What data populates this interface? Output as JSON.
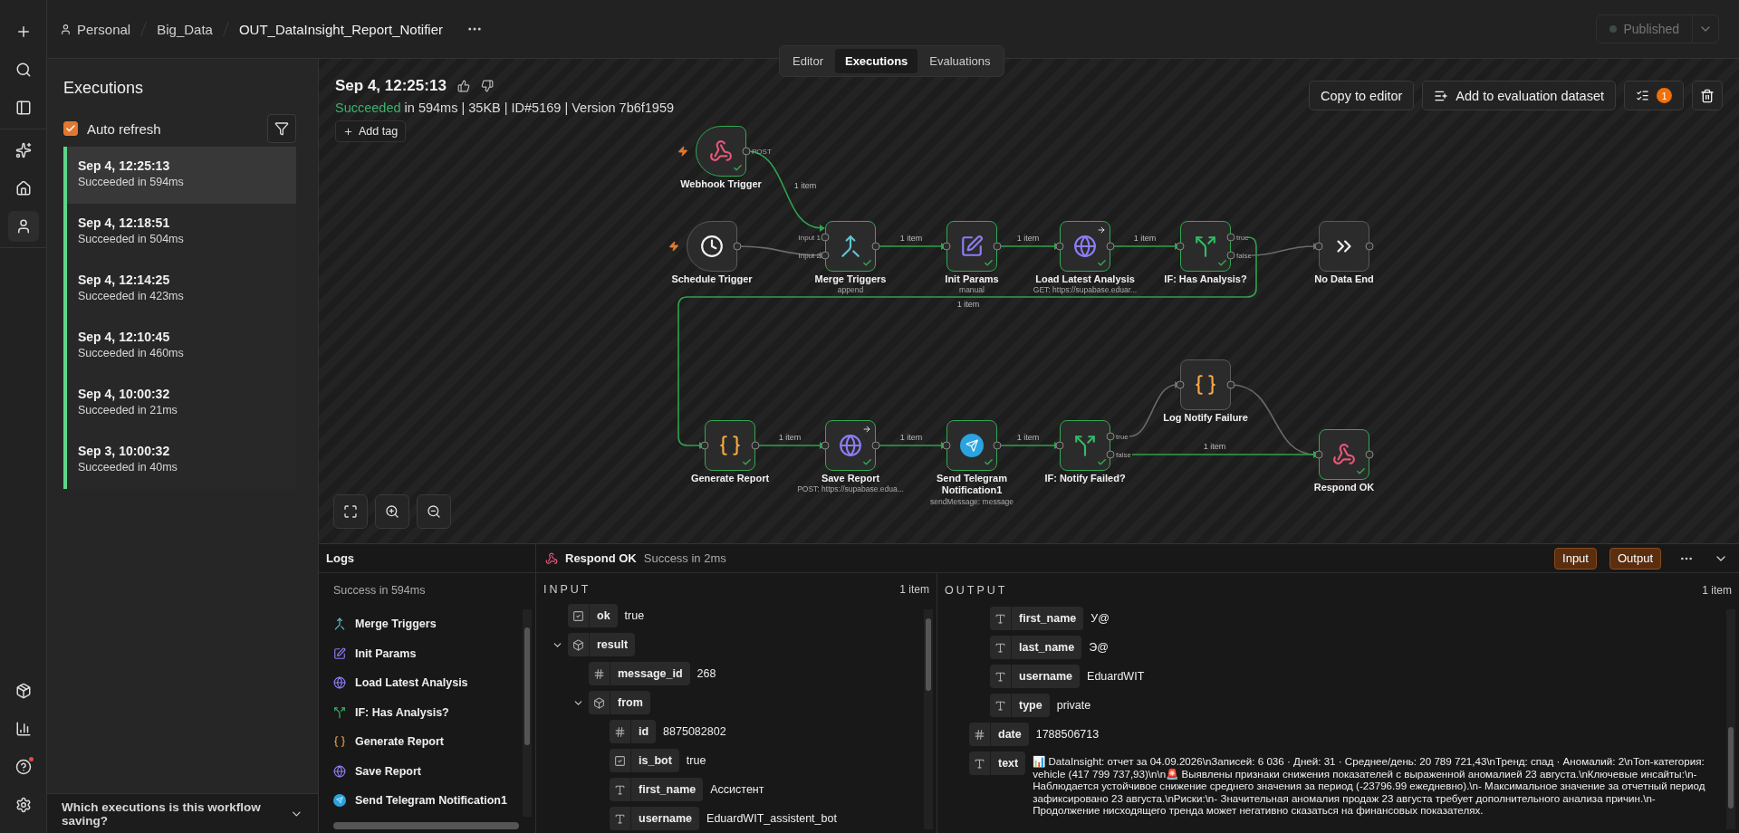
{
  "breadcrumb": {
    "items": [
      "Personal",
      "Big_Data",
      "OUT_DataInsight_Report_Notifier"
    ]
  },
  "publish_button": {
    "label": "Published",
    "disabled": true
  },
  "view_tabs": [
    {
      "label": "Editor",
      "selected": false
    },
    {
      "label": "Executions",
      "selected": true
    },
    {
      "label": "Evaluations",
      "selected": false
    }
  ],
  "executions_panel": {
    "title": "Executions",
    "auto_refresh": {
      "label": "Auto refresh",
      "checked": true
    },
    "items": [
      {
        "date": "Sep 4, 12:25:13",
        "status": "Succeeded in 594ms",
        "failed": false,
        "selected": true
      },
      {
        "date": "Sep 4, 12:18:51",
        "status": "Succeeded in 504ms",
        "failed": false,
        "selected": false
      },
      {
        "date": "Sep 4, 12:14:25",
        "status": "Succeeded in 423ms",
        "failed": false,
        "selected": false
      },
      {
        "date": "Sep 4, 12:10:45",
        "status": "Succeeded in 460ms",
        "failed": false,
        "selected": false
      },
      {
        "date": "Sep 4, 10:00:32",
        "status": "Succeeded in 21ms",
        "failed": false,
        "selected": false
      },
      {
        "date": "Sep 3, 10:00:32",
        "status": "Succeeded in 40ms",
        "failed": false,
        "selected": false
      }
    ],
    "footer": "Which executions is this workflow saving?"
  },
  "execution": {
    "title": "Sep 4, 12:25:13",
    "status_word": "Succeeded",
    "details": "in 594ms | 35KB | ID#5169 | Version 7b6f1959",
    "add_tag": "Add tag"
  },
  "actions": {
    "copy": "Copy to editor",
    "add_dataset": "Add to evaluation dataset",
    "badge": "1"
  },
  "nodes": [
    {
      "name": "Webhook Trigger",
      "kind": "webhook",
      "trigger": true,
      "executed": true,
      "outputs": [
        "POST"
      ]
    },
    {
      "name": "Schedule Trigger",
      "kind": "schedule",
      "trigger": true,
      "executed": false
    },
    {
      "name": "Merge Triggers",
      "subtitle": "append",
      "kind": "merge",
      "trigger": false,
      "executed": true,
      "inputs": [
        "Input 1",
        "Input 2"
      ]
    },
    {
      "name": "Init Params",
      "subtitle": "manual",
      "kind": "edit",
      "trigger": false,
      "executed": true
    },
    {
      "name": "Load Latest Analysis",
      "subtitle": "GET: https://supabase.eduar...",
      "kind": "http",
      "trigger": false,
      "executed": true
    },
    {
      "name": "IF: Has Analysis?",
      "kind": "if",
      "trigger": false,
      "executed": true,
      "outputs": [
        "true",
        "false"
      ]
    },
    {
      "name": "No Data End",
      "kind": "noop",
      "trigger": false,
      "executed": false
    },
    {
      "name": "Generate Report",
      "kind": "code",
      "trigger": false,
      "executed": true
    },
    {
      "name": "Save Report",
      "subtitle": "POST: https://supabase.edua...",
      "kind": "http",
      "trigger": false,
      "executed": true
    },
    {
      "name": "Send Telegram Notification1",
      "subtitle": "sendMessage: message",
      "kind": "telegram",
      "trigger": false,
      "executed": true
    },
    {
      "name": "IF: Notify Failed?",
      "kind": "if",
      "trigger": false,
      "executed": true,
      "outputs": [
        "true",
        "false"
      ]
    },
    {
      "name": "Log Notify Failure",
      "kind": "code",
      "trigger": false,
      "executed": false
    },
    {
      "name": "Respond OK",
      "kind": "webhook",
      "trigger": false,
      "executed": true
    }
  ],
  "edges": [
    {
      "label": "1 item",
      "active": true
    },
    {
      "active": false
    },
    {
      "label": "1 item",
      "active": true
    },
    {
      "label": "1 item",
      "active": true
    },
    {
      "label": "1 item",
      "active": true
    },
    {
      "label": "1 item",
      "active": true
    },
    {
      "active": false
    },
    {
      "label": "1 item",
      "active": true
    },
    {
      "label": "1 item",
      "active": true
    },
    {
      "label": "1 item",
      "active": true
    },
    {
      "active": false
    },
    {
      "active": false
    },
    {
      "label": "1 item",
      "active": true
    }
  ],
  "logs": {
    "title": "Logs",
    "summary": "Success in 594ms",
    "items": [
      {
        "name": "Merge Triggers",
        "kind": "merge"
      },
      {
        "name": "Init Params",
        "kind": "edit"
      },
      {
        "name": "Load Latest Analysis",
        "kind": "http"
      },
      {
        "name": "IF: Has Analysis?",
        "kind": "if"
      },
      {
        "name": "Generate Report",
        "kind": "code"
      },
      {
        "name": "Save Report",
        "kind": "http"
      },
      {
        "name": "Send Telegram Notification1",
        "kind": "telegram"
      }
    ],
    "selected_node": {
      "name": "Respond OK",
      "kind": "webhook",
      "status": "Success in 2ms"
    },
    "toggles": [
      {
        "label": "Input",
        "selected": true
      },
      {
        "label": "Output",
        "selected": true
      }
    ],
    "input": {
      "title": "INPUT",
      "count": "1 item",
      "rows": [
        {
          "kind": "boolean",
          "key": "ok",
          "value": "true"
        },
        {
          "kind": "object",
          "key": "result",
          "expanded": true,
          "children": [
            {
              "kind": "number",
              "key": "message_id",
              "value": "268"
            },
            {
              "kind": "object",
              "key": "from",
              "expanded": true,
              "children": [
                {
                  "kind": "number",
                  "key": "id",
                  "value": "8875082802"
                },
                {
                  "kind": "boolean",
                  "key": "is_bot",
                  "value": "true"
                },
                {
                  "kind": "string",
                  "key": "first_name",
                  "value": "Ассистент"
                },
                {
                  "kind": "string",
                  "key": "username",
                  "value": "EduardWIT_assistent_bot"
                }
              ]
            }
          ]
        }
      ]
    },
    "output": {
      "title": "OUTPUT",
      "count": "1 item",
      "rows": [
        {
          "children": [
            {
              "children": [
                {
                  "kind": "string",
                  "key": "first_name",
                  "value": "У@"
                },
                {
                  "kind": "string",
                  "key": "last_name",
                  "value": "Э@"
                },
                {
                  "kind": "string",
                  "key": "username",
                  "value": "EduardWIT"
                },
                {
                  "kind": "string",
                  "key": "type",
                  "value": "private"
                }
              ]
            },
            {
              "kind": "number",
              "key": "date",
              "value": "1788506713"
            },
            {
              "kind": "string",
              "key": "text",
              "value": "📊 DataInsight: отчет за 04.09.2026\\nЗаписей: 6 036 · Дней: 31 · Среднее/день: 20 789 721,43\\nТренд: спад · Аномалий: 2\\nТоп-категория: vehicle (417 799 737,93)\\n\\n🚨 Выявлены признаки снижения показателей с выраженной аномалией 23 августа.\\nКлючевые инсайты:\\n- Наблюдается устойчивое снижение среднего значения за период (-23796.99 ежедневно).\\n- Максимальное значение за отчетный период зафиксировано 23 августа.\\nРиски:\\n- Значительная аномалия продаж 23 августа требует дополнительного анализа причин.\\n- Продолжение нисходящего тренда может негативно сказаться на финансовых показателях."
            }
          ]
        }
      ]
    }
  }
}
